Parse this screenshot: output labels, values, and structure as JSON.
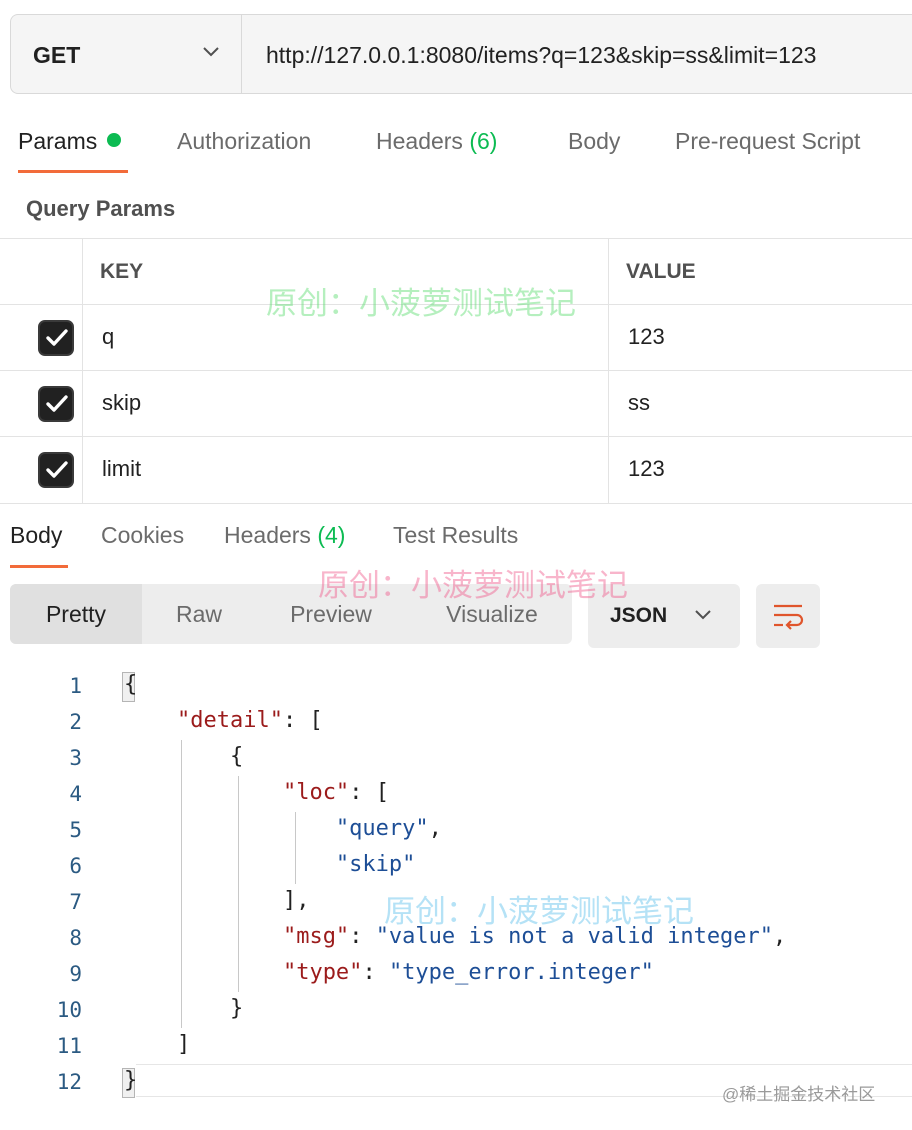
{
  "request": {
    "method": "GET",
    "url": "http://127.0.0.1:8080/items?q=123&skip=ss&limit=123"
  },
  "request_tabs": [
    {
      "label": "Params",
      "active": true
    },
    {
      "label": "Authorization"
    },
    {
      "label": "Headers",
      "count": "(6)"
    },
    {
      "label": "Body"
    },
    {
      "label": "Pre-request Script"
    }
  ],
  "query_params": {
    "title": "Query Params",
    "columns": {
      "key": "KEY",
      "value": "VALUE"
    },
    "rows": [
      {
        "key": "q",
        "value": "123",
        "checked": true
      },
      {
        "key": "skip",
        "value": "ss",
        "checked": true
      },
      {
        "key": "limit",
        "value": "123",
        "checked": true
      }
    ]
  },
  "response_tabs": [
    {
      "label": "Body",
      "active": true
    },
    {
      "label": "Cookies"
    },
    {
      "label": "Headers",
      "count": "(4)"
    },
    {
      "label": "Test Results"
    }
  ],
  "view_modes": [
    "Pretty",
    "Raw",
    "Preview",
    "Visualize"
  ],
  "active_view": "Pretty",
  "format": "JSON",
  "code": {
    "line_numbers": [
      "1",
      "2",
      "3",
      "4",
      "5",
      "6",
      "7",
      "8",
      "9",
      "10",
      "11",
      "12"
    ],
    "lines": [
      {
        "open": "{"
      },
      {
        "key": "\"detail\"",
        "sep": ": ",
        "tail": "["
      },
      {
        "open": "{"
      },
      {
        "key": "\"loc\"",
        "sep": ": ",
        "tail": "["
      },
      {
        "str": "\"query\"",
        "tail": ","
      },
      {
        "str": "\"skip\""
      },
      {
        "tail": "],"
      },
      {
        "key": "\"msg\"",
        "sep": ": ",
        "str": "\"value is not a valid integer\"",
        "tail": ","
      },
      {
        "key": "\"type\"",
        "sep": ": ",
        "str": "\"type_error.integer\""
      },
      {
        "tail": "}"
      },
      {
        "tail": "]"
      },
      {
        "tail": "}"
      }
    ]
  },
  "watermark": "原创：小菠萝测试笔记",
  "corner_watermark": "@稀土掘金技术社区",
  "colors": {
    "accent": "#f26b3a",
    "count_green": "#0cbb52",
    "json_key": "#9b1b1b",
    "json_string": "#1d4e96"
  }
}
